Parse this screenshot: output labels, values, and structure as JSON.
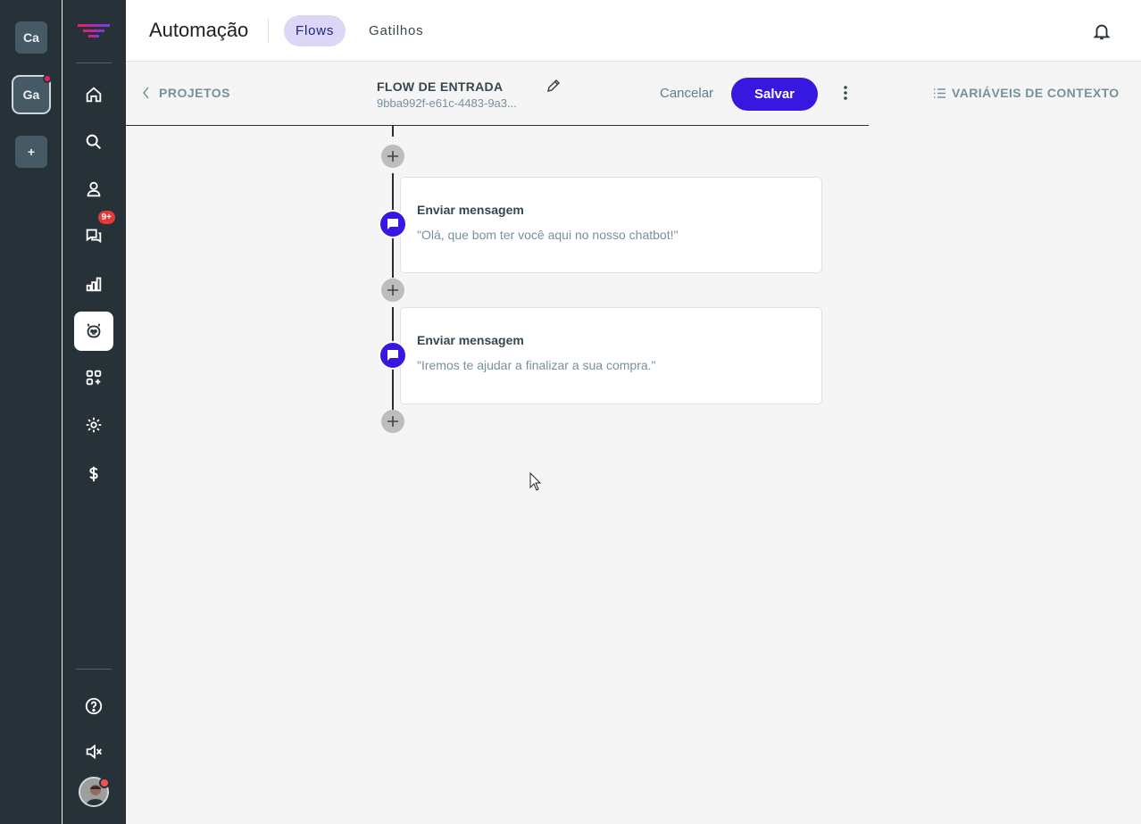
{
  "workspaces": [
    {
      "label": "Ca",
      "active": false,
      "notify": false
    },
    {
      "label": "Ga",
      "active": true,
      "notify": true
    },
    {
      "label": "+",
      "active": false,
      "notify": false
    }
  ],
  "nav": {
    "items": [
      {
        "icon": "home-icon"
      },
      {
        "icon": "search-icon"
      },
      {
        "icon": "user-icon"
      },
      {
        "icon": "chat-icon",
        "badge": "9+"
      },
      {
        "icon": "chart-icon"
      },
      {
        "icon": "bot-icon",
        "active": true
      },
      {
        "icon": "apps-icon"
      },
      {
        "icon": "settings-icon"
      },
      {
        "icon": "dollar-icon"
      }
    ],
    "bottom": [
      {
        "icon": "help-icon"
      },
      {
        "icon": "mute-icon"
      },
      {
        "icon": "avatar"
      }
    ]
  },
  "header": {
    "title": "Automação",
    "tabs": [
      {
        "label": "Flows",
        "active": true
      },
      {
        "label": "Gatilhos",
        "active": false
      }
    ]
  },
  "subheader": {
    "back_label": "PROJETOS",
    "flow_name": "FLOW DE ENTRADA",
    "flow_id": "9bba992f-e61c-4483-9a3...",
    "cancel_label": "Cancelar",
    "save_label": "Salvar",
    "context_label": "VARIÁVEIS DE CONTEXTO"
  },
  "flow": {
    "steps": [
      {
        "title": "Enviar mensagem",
        "text": "\"Olá, que bom ter você aqui no nosso chatbot!\""
      },
      {
        "title": "Enviar mensagem",
        "text": "\"Iremos te ajudar a finalizar a sua compra.\""
      }
    ]
  },
  "colors": {
    "primary": "#3718e0",
    "sidebar": "#263238",
    "tab_active_bg": "#dcd6f7",
    "badge": "#e53935"
  }
}
